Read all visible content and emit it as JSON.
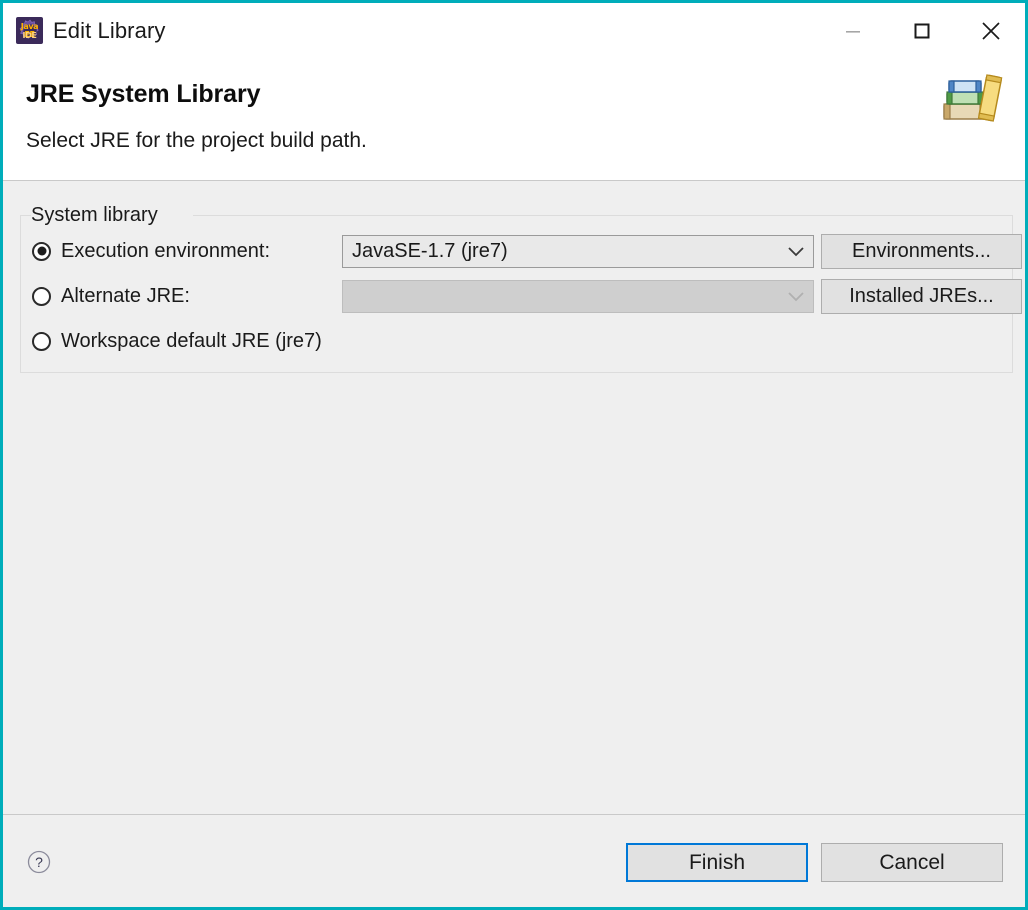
{
  "window": {
    "title": "Edit Library",
    "app_icon_name": "eclipse-java-ee-ide-icon",
    "app_icon_line1": "Java EE",
    "app_icon_line2": "IDE",
    "border_color": "#00adba",
    "controls": {
      "minimize_label": "Minimize",
      "maximize_label": "Maximize",
      "close_label": "Close"
    }
  },
  "banner": {
    "title": "JRE System Library",
    "subtitle": "Select JRE for the project build path.",
    "icon_name": "books-stack-icon"
  },
  "group": {
    "label": "System library",
    "options": [
      {
        "id": "execution-environment",
        "label": "Execution environment:",
        "selected": true,
        "combo": {
          "value": "JavaSE-1.7 (jre7)",
          "enabled": true
        },
        "button": "Environments..."
      },
      {
        "id": "alternate-jre",
        "label": "Alternate JRE:",
        "selected": false,
        "combo": {
          "value": "",
          "enabled": false
        },
        "button": "Installed JREs..."
      },
      {
        "id": "workspace-default-jre",
        "label": "Workspace default JRE (jre7)",
        "selected": false
      }
    ]
  },
  "footer": {
    "help_icon_name": "help-question-icon",
    "help_label": "?",
    "finish_label": "Finish",
    "cancel_label": "Cancel",
    "focus_color": "#0078d7"
  }
}
